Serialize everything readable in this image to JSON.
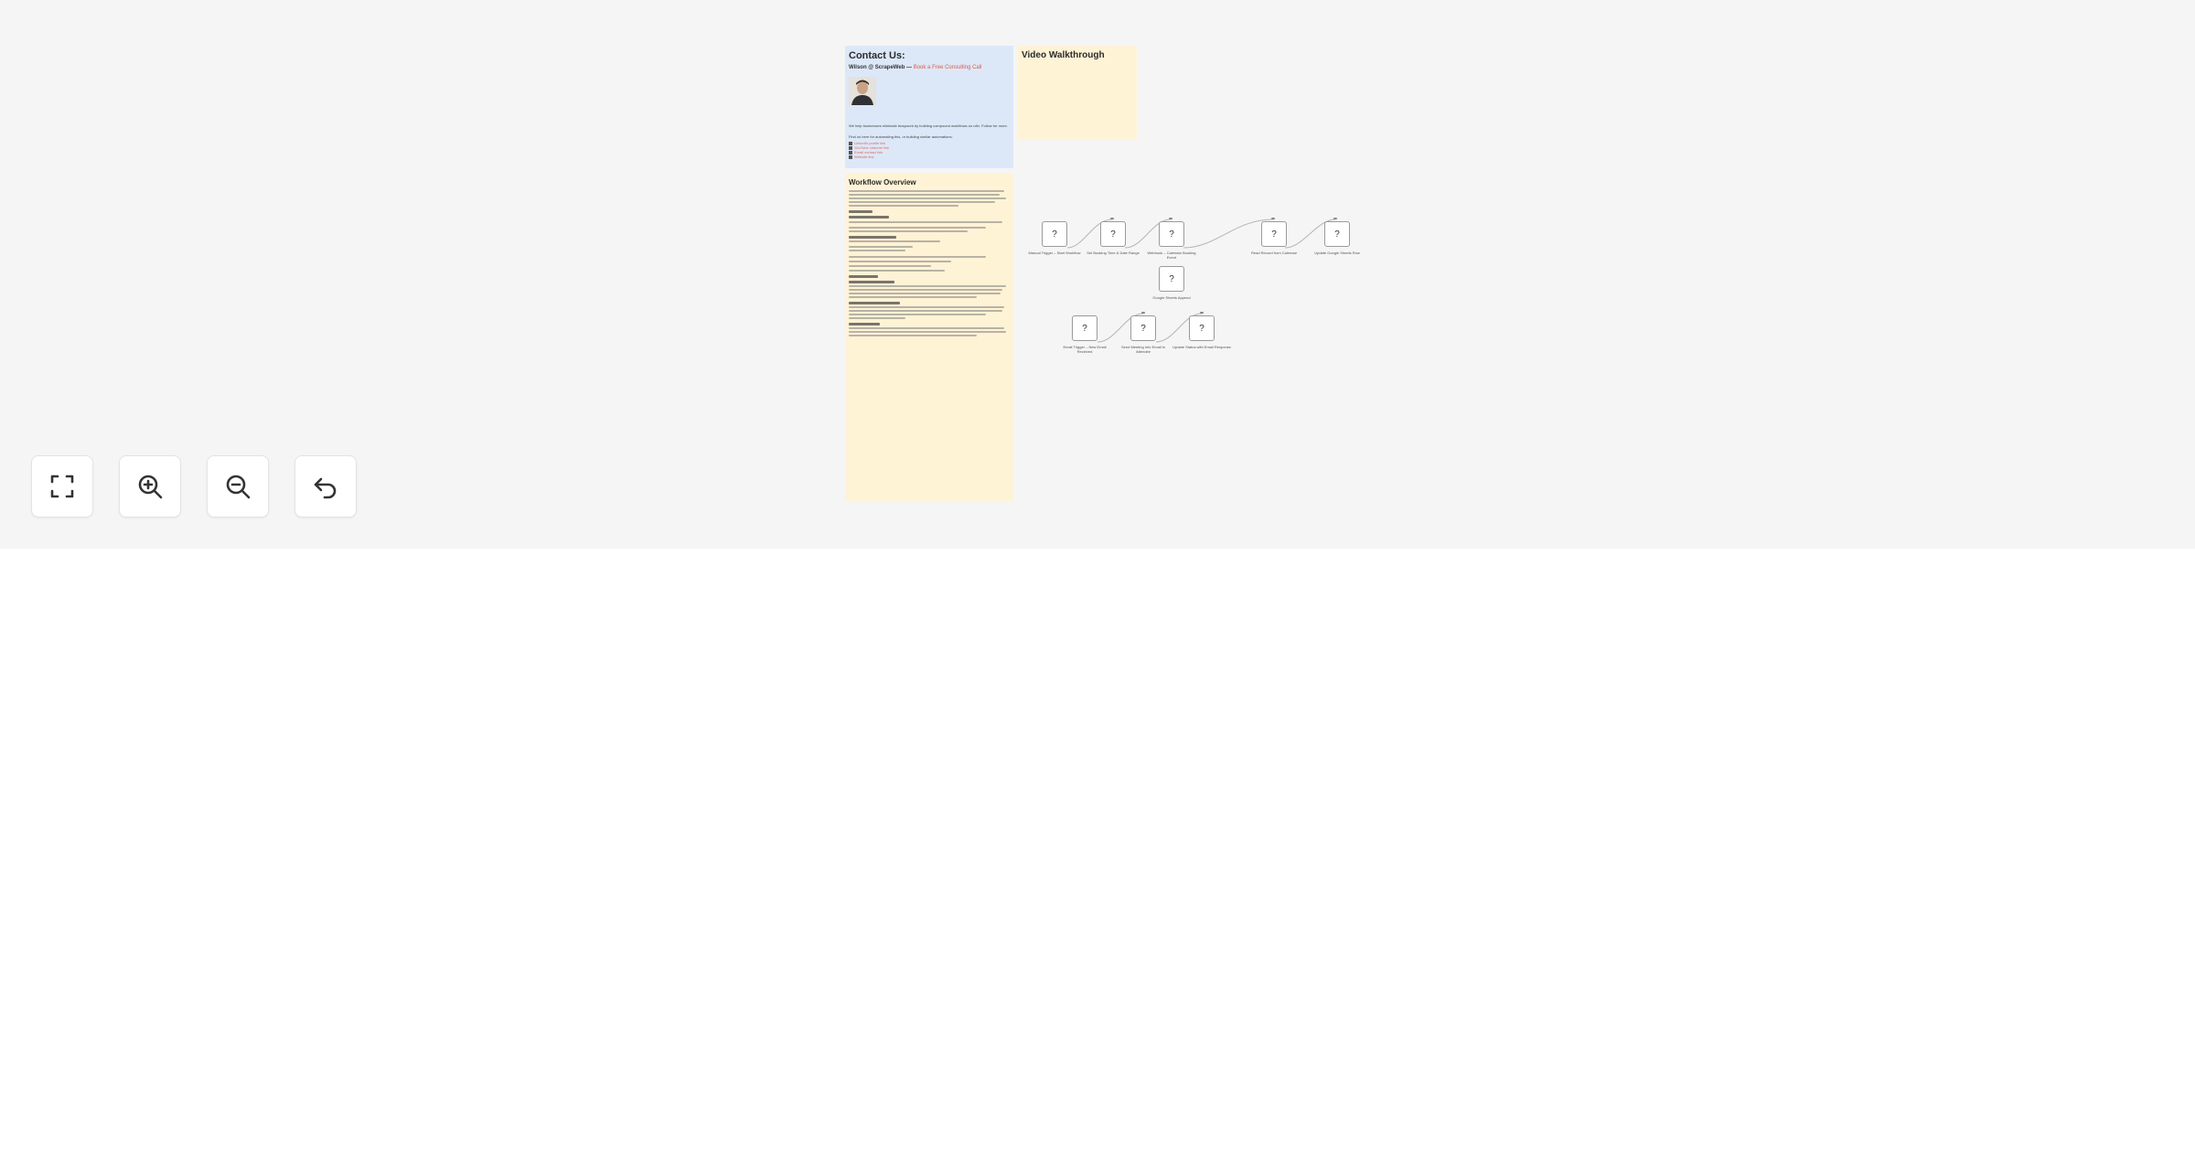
{
  "contact": {
    "title": "Contact Us:",
    "name": "Wilson @ ScrapeWeb —",
    "booking_link": "Book a Free Consulting Call",
    "description": "We help businesses eliminate busywork by building compound workflows on n8n. Follow for more.",
    "prompt": "Find us here for automating this, or building similar automations:",
    "links": [
      "LinkedIn profile link",
      "YouTube channel link",
      "Email contact link",
      "Website link"
    ]
  },
  "video": {
    "title": "Video Walkthrough"
  },
  "overview": {
    "title": "Workflow Overview"
  },
  "nodes": [
    {
      "label": "Manual Trigger – Start Workflow",
      "icon": "?"
    },
    {
      "label": "Set Booking Time & Date Range",
      "icon": "?"
    },
    {
      "label": "Webhook – Calendar Booking Event",
      "icon": "?"
    },
    {
      "label": "Read Record from Calendar",
      "icon": "?"
    },
    {
      "label": "Update Google Sheets Row",
      "icon": "?"
    },
    {
      "label": "Google Sheets Append",
      "icon": "?"
    },
    {
      "label": "Email Trigger – New Email Received",
      "icon": "?"
    },
    {
      "label": "Send Meeting Info Email to Attendee",
      "icon": "?"
    },
    {
      "label": "Update Status with Email Response",
      "icon": "?"
    }
  ],
  "controls": {
    "fit_view": "fit-view",
    "zoom_in": "zoom-in",
    "zoom_out": "zoom-out",
    "undo": "undo"
  },
  "colors": {
    "canvas": "#f5f5f5",
    "contact_note": "#dce8f8",
    "sticky_note": "#fff3d6",
    "link": "#e05a47"
  }
}
